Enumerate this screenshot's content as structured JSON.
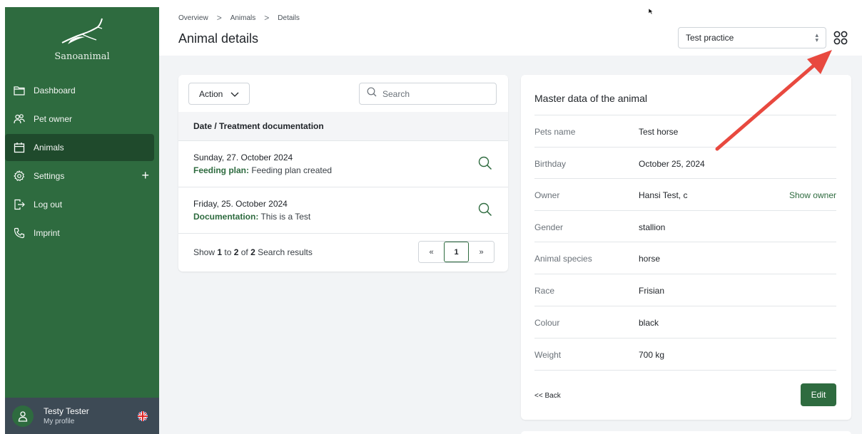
{
  "brand": {
    "name": "Sanoanimal"
  },
  "sidebar": {
    "items": [
      {
        "label": "Dashboard",
        "icon": "folder-icon",
        "active": false
      },
      {
        "label": "Pet owner",
        "icon": "users-icon",
        "active": false
      },
      {
        "label": "Animals",
        "icon": "calendar-icon",
        "active": true
      },
      {
        "label": "Settings",
        "icon": "gear-icon",
        "active": false
      },
      {
        "label": "Log out",
        "icon": "logout-icon",
        "active": false
      },
      {
        "label": "Imprint",
        "icon": "phone-icon",
        "active": false
      }
    ],
    "settings_plus": "+"
  },
  "profile": {
    "name": "Testy Tester",
    "subtitle": "My profile",
    "language_icon": "uk-flag-icon"
  },
  "header": {
    "breadcrumb": [
      "Overview",
      "Animals",
      "Details"
    ],
    "breadcrumb_separator": ">",
    "title": "Animal details",
    "practice_select": {
      "value": "Test practice"
    },
    "apps_icon": "grid-apps-icon"
  },
  "treatments": {
    "action_label": "Action",
    "search_placeholder": "Search",
    "column_header": "Date / Treatment documentation",
    "rows": [
      {
        "date": "Sunday, 27. October 2024",
        "type": "Feeding plan:",
        "text": " Feeding plan created"
      },
      {
        "date": "Friday, 25. October 2024",
        "type": "Documentation:",
        "text": " This is a Test"
      }
    ],
    "results": {
      "prefix": "Show ",
      "from": "1",
      "to_word": " to ",
      "to": "2",
      "of_word": " of ",
      "total": "2",
      "suffix": " Search results"
    },
    "pager": {
      "prev": "«",
      "current": "1",
      "next": "»"
    }
  },
  "master_data": {
    "title": "Master data of the animal",
    "fields": [
      {
        "label": "Pets name",
        "value": "Test horse"
      },
      {
        "label": "Birthday",
        "value": "October 25, 2024"
      },
      {
        "label": "Owner",
        "value": "Hansi Test, c",
        "link": "Show owner"
      },
      {
        "label": "Gender",
        "value": "stallion"
      },
      {
        "label": "Animal species",
        "value": "horse"
      },
      {
        "label": "Race",
        "value": "Frisian"
      },
      {
        "label": "Colour",
        "value": "black"
      },
      {
        "label": "Weight",
        "value": "700 kg"
      }
    ],
    "back_label": "<< Back",
    "edit_label": "Edit"
  },
  "colors": {
    "sidebar": "#2e6b3f",
    "sidebar_active": "#1f4a2c",
    "accent": "#2e6b3f",
    "annotation_arrow": "#e8493f"
  }
}
